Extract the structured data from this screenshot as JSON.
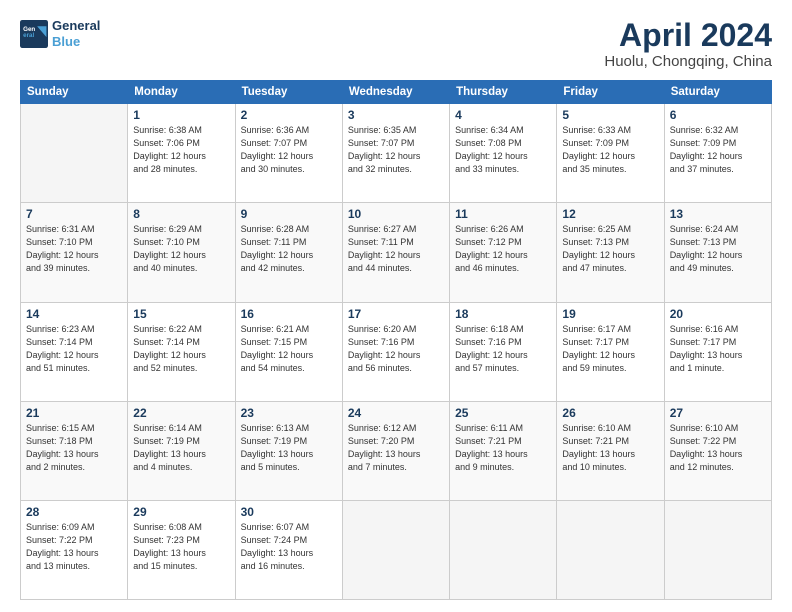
{
  "header": {
    "logo_line1": "General",
    "logo_line2": "Blue",
    "title": "April 2024",
    "subtitle": "Huolu, Chongqing, China"
  },
  "columns": [
    "Sunday",
    "Monday",
    "Tuesday",
    "Wednesday",
    "Thursday",
    "Friday",
    "Saturday"
  ],
  "weeks": [
    [
      {
        "day": "",
        "info": ""
      },
      {
        "day": "1",
        "info": "Sunrise: 6:38 AM\nSunset: 7:06 PM\nDaylight: 12 hours\nand 28 minutes."
      },
      {
        "day": "2",
        "info": "Sunrise: 6:36 AM\nSunset: 7:07 PM\nDaylight: 12 hours\nand 30 minutes."
      },
      {
        "day": "3",
        "info": "Sunrise: 6:35 AM\nSunset: 7:07 PM\nDaylight: 12 hours\nand 32 minutes."
      },
      {
        "day": "4",
        "info": "Sunrise: 6:34 AM\nSunset: 7:08 PM\nDaylight: 12 hours\nand 33 minutes."
      },
      {
        "day": "5",
        "info": "Sunrise: 6:33 AM\nSunset: 7:09 PM\nDaylight: 12 hours\nand 35 minutes."
      },
      {
        "day": "6",
        "info": "Sunrise: 6:32 AM\nSunset: 7:09 PM\nDaylight: 12 hours\nand 37 minutes."
      }
    ],
    [
      {
        "day": "7",
        "info": "Sunrise: 6:31 AM\nSunset: 7:10 PM\nDaylight: 12 hours\nand 39 minutes."
      },
      {
        "day": "8",
        "info": "Sunrise: 6:29 AM\nSunset: 7:10 PM\nDaylight: 12 hours\nand 40 minutes."
      },
      {
        "day": "9",
        "info": "Sunrise: 6:28 AM\nSunset: 7:11 PM\nDaylight: 12 hours\nand 42 minutes."
      },
      {
        "day": "10",
        "info": "Sunrise: 6:27 AM\nSunset: 7:11 PM\nDaylight: 12 hours\nand 44 minutes."
      },
      {
        "day": "11",
        "info": "Sunrise: 6:26 AM\nSunset: 7:12 PM\nDaylight: 12 hours\nand 46 minutes."
      },
      {
        "day": "12",
        "info": "Sunrise: 6:25 AM\nSunset: 7:13 PM\nDaylight: 12 hours\nand 47 minutes."
      },
      {
        "day": "13",
        "info": "Sunrise: 6:24 AM\nSunset: 7:13 PM\nDaylight: 12 hours\nand 49 minutes."
      }
    ],
    [
      {
        "day": "14",
        "info": "Sunrise: 6:23 AM\nSunset: 7:14 PM\nDaylight: 12 hours\nand 51 minutes."
      },
      {
        "day": "15",
        "info": "Sunrise: 6:22 AM\nSunset: 7:14 PM\nDaylight: 12 hours\nand 52 minutes."
      },
      {
        "day": "16",
        "info": "Sunrise: 6:21 AM\nSunset: 7:15 PM\nDaylight: 12 hours\nand 54 minutes."
      },
      {
        "day": "17",
        "info": "Sunrise: 6:20 AM\nSunset: 7:16 PM\nDaylight: 12 hours\nand 56 minutes."
      },
      {
        "day": "18",
        "info": "Sunrise: 6:18 AM\nSunset: 7:16 PM\nDaylight: 12 hours\nand 57 minutes."
      },
      {
        "day": "19",
        "info": "Sunrise: 6:17 AM\nSunset: 7:17 PM\nDaylight: 12 hours\nand 59 minutes."
      },
      {
        "day": "20",
        "info": "Sunrise: 6:16 AM\nSunset: 7:17 PM\nDaylight: 13 hours\nand 1 minute."
      }
    ],
    [
      {
        "day": "21",
        "info": "Sunrise: 6:15 AM\nSunset: 7:18 PM\nDaylight: 13 hours\nand 2 minutes."
      },
      {
        "day": "22",
        "info": "Sunrise: 6:14 AM\nSunset: 7:19 PM\nDaylight: 13 hours\nand 4 minutes."
      },
      {
        "day": "23",
        "info": "Sunrise: 6:13 AM\nSunset: 7:19 PM\nDaylight: 13 hours\nand 5 minutes."
      },
      {
        "day": "24",
        "info": "Sunrise: 6:12 AM\nSunset: 7:20 PM\nDaylight: 13 hours\nand 7 minutes."
      },
      {
        "day": "25",
        "info": "Sunrise: 6:11 AM\nSunset: 7:21 PM\nDaylight: 13 hours\nand 9 minutes."
      },
      {
        "day": "26",
        "info": "Sunrise: 6:10 AM\nSunset: 7:21 PM\nDaylight: 13 hours\nand 10 minutes."
      },
      {
        "day": "27",
        "info": "Sunrise: 6:10 AM\nSunset: 7:22 PM\nDaylight: 13 hours\nand 12 minutes."
      }
    ],
    [
      {
        "day": "28",
        "info": "Sunrise: 6:09 AM\nSunset: 7:22 PM\nDaylight: 13 hours\nand 13 minutes."
      },
      {
        "day": "29",
        "info": "Sunrise: 6:08 AM\nSunset: 7:23 PM\nDaylight: 13 hours\nand 15 minutes."
      },
      {
        "day": "30",
        "info": "Sunrise: 6:07 AM\nSunset: 7:24 PM\nDaylight: 13 hours\nand 16 minutes."
      },
      {
        "day": "",
        "info": ""
      },
      {
        "day": "",
        "info": ""
      },
      {
        "day": "",
        "info": ""
      },
      {
        "day": "",
        "info": ""
      }
    ]
  ]
}
